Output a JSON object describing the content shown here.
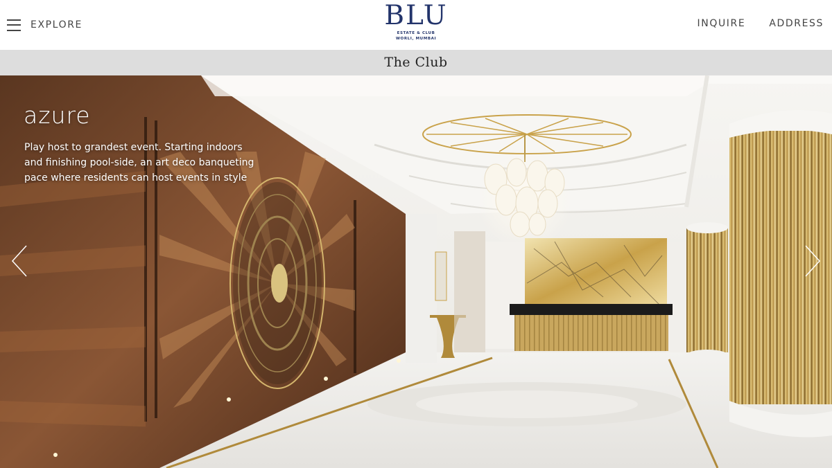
{
  "header": {
    "explore_label": "EXPLORE",
    "logo": {
      "title": "BLU",
      "subtitle_line1": "ESTATE & CLUB",
      "subtitle_line2": "WORLI, MUMBAI"
    },
    "nav": {
      "inquire_label": "INQUIRE",
      "address_label": "ADDRESS"
    }
  },
  "section": {
    "title": "The Club"
  },
  "slide": {
    "title": "azure",
    "description": "Play host to grandest event. Starting indoors and finishing pool-side, an art deco banqueting pace where residents can host events in style"
  },
  "colors": {
    "brand": "#23346b",
    "section_bar": "#dddddd",
    "gold": "#c9a44a",
    "wood": "#7a4a2b"
  },
  "icons": {
    "menu": "hamburger-icon",
    "prev": "chevron-left-icon",
    "next": "chevron-right-icon"
  }
}
